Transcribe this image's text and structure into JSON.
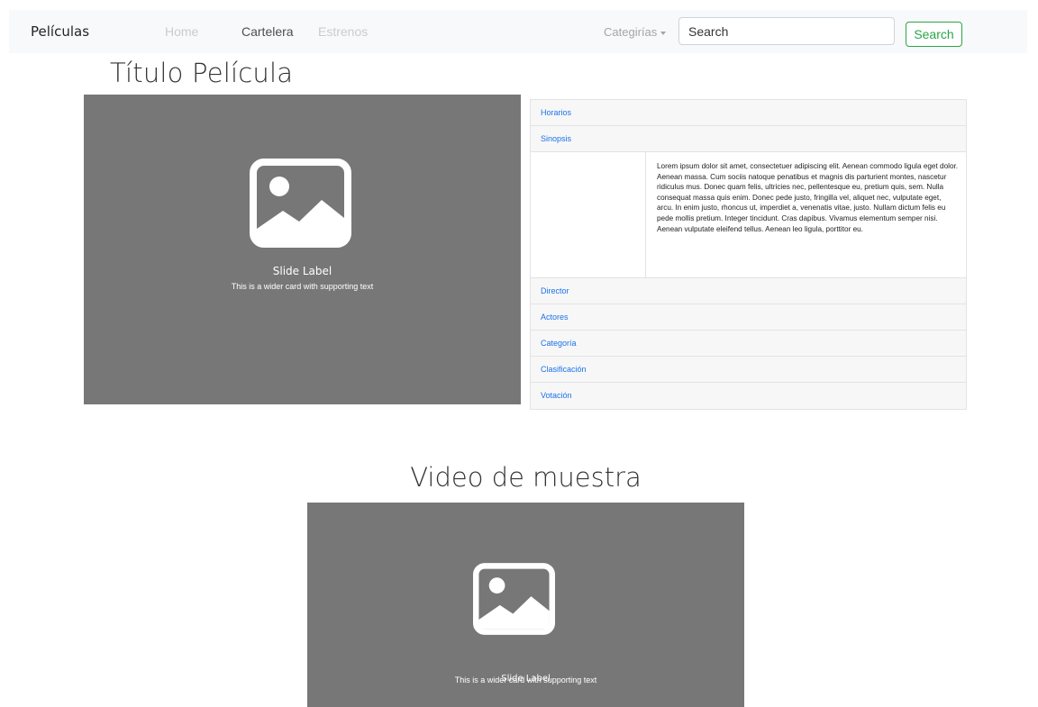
{
  "navbar": {
    "brand": "Películas",
    "links": [
      "Home",
      "Cartelera",
      "Estrenos"
    ],
    "dropdown": "Categirías",
    "search_placeholder": "Search",
    "search_button": "Search"
  },
  "movie": {
    "title": "Título Película",
    "slide_label": "Slide Label",
    "slide_text": "This is a wider card with supporting text"
  },
  "accordion": {
    "items": [
      "Horarios",
      "Sinopsis",
      "Director",
      "Actores",
      "Categoría",
      "Clasificación",
      "Votación"
    ],
    "expanded": "Sinopsis",
    "synopsis": "Lorem ipsum dolor sit amet, consectetuer adipiscing elit. Aenean commodo ligula eget dolor. Aenean massa. Cum sociis natoque penatibus et magnis dis parturient montes, nascetur ridiculus mus. Donec quam felis, ultricies nec, pellentesque eu, pretium quis, sem. Nulla consequat massa quis enim. Donec pede justo, fringilla vel, aliquet nec, vulputate eget, arcu. In enim justo, rhoncus ut, imperdiet a, venenatis vitae, justo. Nullam dictum felis eu pede mollis pretium. Integer tincidunt. Cras dapibus. Vivamus elementum semper nisi. Aenean vulputate eleifend tellus. Aenean leo ligula, porttitor eu."
  },
  "video": {
    "title": "Video de muestra",
    "slide_label": "Slide Label",
    "slide_text": "This is a wider card with supporting text"
  },
  "colors": {
    "navbar_bg": "#f8f9fa",
    "slide_bg": "#777777",
    "link": "#1a73e8",
    "search_button": "#28a745"
  },
  "icons": {
    "image_placeholder": "image-icon",
    "dropdown_caret": "caret-down-icon"
  }
}
